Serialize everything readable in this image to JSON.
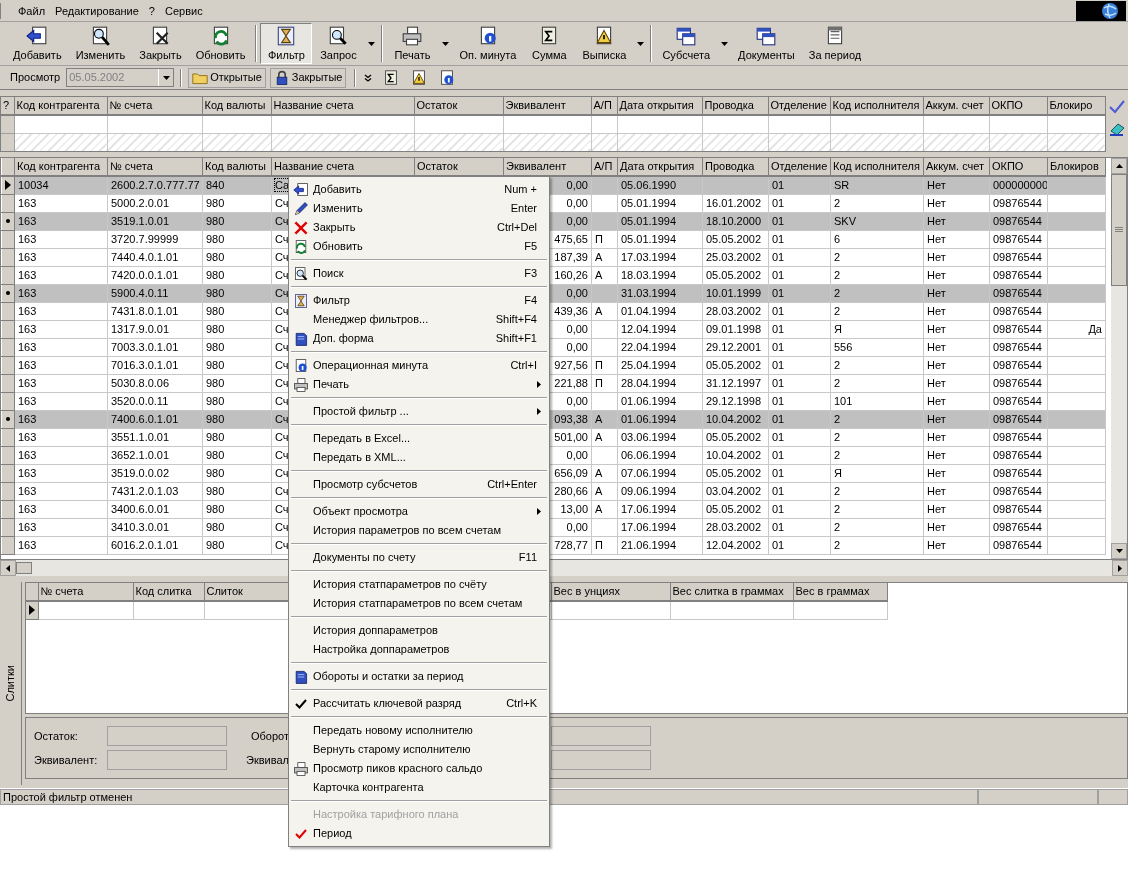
{
  "menu_bar": [
    {
      "label": "Файл"
    },
    {
      "label": "Редактирование"
    },
    {
      "label": "?"
    },
    {
      "label": "Сервис"
    }
  ],
  "toolbar": [
    {
      "kind": "button",
      "label": "Добавить",
      "pressed": false
    },
    {
      "kind": "button",
      "label": "Изменить",
      "pressed": false
    },
    {
      "kind": "button",
      "label": "Закрыть",
      "pressed": false
    },
    {
      "kind": "button",
      "label": "Обновить",
      "pressed": false
    },
    {
      "kind": "separator"
    },
    {
      "kind": "button",
      "label": "Фильтр",
      "pressed": true
    },
    {
      "kind": "button",
      "label": "Запрос",
      "pressed": false,
      "dropdown": true
    },
    {
      "kind": "separator"
    },
    {
      "kind": "button",
      "label": "Печать",
      "pressed": false,
      "dropdown": true
    },
    {
      "kind": "button",
      "label": "Оп. минута",
      "pressed": false
    },
    {
      "kind": "button",
      "label": "Сумма",
      "pressed": false
    },
    {
      "kind": "button",
      "label": "Выписка",
      "pressed": false,
      "dropdown": true
    },
    {
      "kind": "separator"
    },
    {
      "kind": "button",
      "label": "Субсчета",
      "pressed": false,
      "dropdown": true
    },
    {
      "kind": "button",
      "label": "Документы",
      "pressed": false
    },
    {
      "kind": "button",
      "label": "За период",
      "pressed": false
    }
  ],
  "view_bar": {
    "label": "Просмотр",
    "date": "05.05.2002",
    "date_disabled": true,
    "buttons": [
      {
        "label": "Открытые"
      },
      {
        "label": "Закрытые"
      }
    ]
  },
  "filter_grid": {
    "corner": "?",
    "columns": [
      "Код контрагента",
      "№ счета",
      "Код валюты",
      "Название счета",
      "Остаток",
      "Эквивалент",
      "А/П",
      "Дата открытия",
      "Проводка",
      "Отделение",
      "Код исполнителя",
      "Аккум. счет",
      "ОКПО",
      "Блокиро"
    ]
  },
  "main_grid": {
    "columns": [
      "Код контрагента",
      "№ счета",
      "Код валюты",
      "Название счета",
      "Остаток",
      "Эквивалент",
      "А/П",
      "Дата открытия",
      "Проводка",
      "Отделение",
      "Код исполнителя",
      "Аккум. счет",
      "ОКПО",
      "Блокиров"
    ],
    "rows": [
      {
        "current": true,
        "selected": true,
        "cells": [
          "10034",
          "2600.2.7.0.777.77",
          "840",
          "Са",
          null,
          "0,00",
          null,
          "05.06.1990",
          null,
          "01",
          "SR",
          "Нет",
          "000000000",
          null
        ]
      },
      {
        "current": false,
        "marked": false,
        "selected": false,
        "cells": [
          "163",
          "5000.2.0.01",
          "980",
          "Сч",
          null,
          "0,00",
          null,
          "05.01.1994",
          "16.01.2002",
          "01",
          "2",
          "Нет",
          "09876544",
          null
        ]
      },
      {
        "current": false,
        "marked": true,
        "selected": true,
        "cells": [
          "163",
          "3519.1.0.01",
          "980",
          "Сч",
          null,
          "0,00",
          null,
          "05.01.1994",
          "18.10.2000",
          "01",
          "SKV",
          "Нет",
          "09876544",
          null
        ]
      },
      {
        "current": false,
        "marked": false,
        "selected": false,
        "cells": [
          "163",
          "3720.7.99999",
          "980",
          "Сч",
          null,
          "475,65",
          "П",
          "05.01.1994",
          "05.05.2002",
          "01",
          "6",
          "Нет",
          "09876544",
          null
        ]
      },
      {
        "current": false,
        "marked": false,
        "selected": false,
        "cells": [
          "163",
          "7440.4.0.1.01",
          "980",
          "Сч",
          null,
          "187,39",
          "А",
          "17.03.1994",
          "25.03.2002",
          "01",
          "2",
          "Нет",
          "09876544",
          null
        ]
      },
      {
        "current": false,
        "marked": false,
        "selected": false,
        "cells": [
          "163",
          "7420.0.0.1.01",
          "980",
          "Сч",
          null,
          "160,26",
          "А",
          "18.03.1994",
          "05.05.2002",
          "01",
          "2",
          "Нет",
          "09876544",
          null
        ]
      },
      {
        "current": false,
        "marked": true,
        "selected": true,
        "cells": [
          "163",
          "5900.4.0.11",
          "980",
          "Сч",
          null,
          "0,00",
          null,
          "31.03.1994",
          "10.01.1999",
          "01",
          "2",
          "Нет",
          "09876544",
          null
        ]
      },
      {
        "current": false,
        "marked": false,
        "selected": false,
        "cells": [
          "163",
          "7431.8.0.1.01",
          "980",
          "Сч",
          null,
          "439,36",
          "А",
          "01.04.1994",
          "28.03.2002",
          "01",
          "2",
          "Нет",
          "09876544",
          null
        ]
      },
      {
        "current": false,
        "marked": false,
        "selected": false,
        "cells": [
          "163",
          "1317.9.0.01",
          "980",
          "Сч",
          null,
          "0,00",
          null,
          "12.04.1994",
          "09.01.1998",
          "01",
          "Я",
          "Нет",
          "09876544",
          "Да"
        ]
      },
      {
        "current": false,
        "marked": false,
        "selected": false,
        "cells": [
          "163",
          "7003.3.0.1.01",
          "980",
          "Сч",
          null,
          "0,00",
          null,
          "22.04.1994",
          "29.12.2001",
          "01",
          "556",
          "Нет",
          "09876544",
          null
        ]
      },
      {
        "current": false,
        "marked": false,
        "selected": false,
        "cells": [
          "163",
          "7016.3.0.1.01",
          "980",
          "Сч",
          null,
          "927,56",
          "П",
          "25.04.1994",
          "05.05.2002",
          "01",
          "2",
          "Нет",
          "09876544",
          null
        ]
      },
      {
        "current": false,
        "marked": false,
        "selected": false,
        "cells": [
          "163",
          "5030.8.0.06",
          "980",
          "Сч",
          null,
          "221,88",
          "П",
          "28.04.1994",
          "31.12.1997",
          "01",
          "2",
          "Нет",
          "09876544",
          null
        ]
      },
      {
        "current": false,
        "marked": false,
        "selected": false,
        "cells": [
          "163",
          "3520.0.0.11",
          "980",
          "Сч",
          null,
          "0,00",
          null,
          "01.06.1994",
          "29.12.1998",
          "01",
          "101",
          "Нет",
          "09876544",
          null
        ]
      },
      {
        "current": false,
        "marked": true,
        "selected": true,
        "cells": [
          "163",
          "7400.6.0.1.01",
          "980",
          "Сч",
          null,
          "093,38",
          "А",
          "01.06.1994",
          "10.04.2002",
          "01",
          "2",
          "Нет",
          "09876544",
          null
        ]
      },
      {
        "current": false,
        "marked": false,
        "selected": false,
        "cells": [
          "163",
          "3551.1.0.01",
          "980",
          "Сч",
          null,
          "501,00",
          "А",
          "03.06.1994",
          "05.05.2002",
          "01",
          "2",
          "Нет",
          "09876544",
          null
        ]
      },
      {
        "current": false,
        "marked": false,
        "selected": false,
        "cells": [
          "163",
          "3652.1.0.01",
          "980",
          "Сч",
          null,
          "0,00",
          null,
          "06.06.1994",
          "10.04.2002",
          "01",
          "2",
          "Нет",
          "09876544",
          null
        ]
      },
      {
        "current": false,
        "marked": false,
        "selected": false,
        "cells": [
          "163",
          "3519.0.0.02",
          "980",
          "Сч",
          null,
          "656,09",
          "А",
          "07.06.1994",
          "05.05.2002",
          "01",
          "Я",
          "Нет",
          "09876544",
          null
        ]
      },
      {
        "current": false,
        "marked": false,
        "selected": false,
        "cells": [
          "163",
          "7431.2.0.1.03",
          "980",
          "Сч",
          null,
          "280,66",
          "А",
          "09.06.1994",
          "03.04.2002",
          "01",
          "2",
          "Нет",
          "09876544",
          null
        ]
      },
      {
        "current": false,
        "marked": false,
        "selected": false,
        "cells": [
          "163",
          "3400.6.0.01",
          "980",
          "Сч",
          null,
          "13,00",
          "А",
          "17.06.1994",
          "05.05.2002",
          "01",
          "2",
          "Нет",
          "09876544",
          null
        ]
      },
      {
        "current": false,
        "marked": false,
        "selected": false,
        "cells": [
          "163",
          "3410.3.0.01",
          "980",
          "Сч",
          null,
          "0,00",
          null,
          "17.06.1994",
          "28.03.2002",
          "01",
          "2",
          "Нет",
          "09876544",
          null
        ]
      },
      {
        "current": false,
        "marked": false,
        "selected": false,
        "cells": [
          "163",
          "6016.2.0.1.01",
          "980",
          "Сч",
          null,
          "728,77",
          "П",
          "21.06.1994",
          "12.04.2002",
          "01",
          "2",
          "Нет",
          "09876544",
          null
        ]
      }
    ]
  },
  "bars_panel": {
    "tab": "Слитки",
    "columns": [
      "№ счета",
      "Код слитка",
      "Слиток",
      null,
      "Вес в унциях",
      "Вес слитка в граммах",
      "Вес в граммах"
    ],
    "totals": [
      {
        "label": "Остаток:",
        "label2": "Оборот"
      },
      {
        "label": "Эквивалент:",
        "label2": "Эквивал"
      }
    ]
  },
  "status_bar": {
    "text": "Простой фильтр отменен"
  },
  "context_menu": [
    {
      "kind": "item",
      "label": "Добавить",
      "shortcut": "Num +"
    },
    {
      "kind": "item",
      "label": "Изменить",
      "shortcut": "Enter"
    },
    {
      "kind": "item",
      "label": "Закрыть",
      "shortcut": "Ctrl+Del"
    },
    {
      "kind": "item",
      "label": "Обновить",
      "shortcut": "F5"
    },
    {
      "kind": "separator"
    },
    {
      "kind": "item",
      "label": "Поиск",
      "shortcut": "F3"
    },
    {
      "kind": "separator"
    },
    {
      "kind": "item",
      "label": "Фильтр",
      "shortcut": "F4"
    },
    {
      "kind": "item",
      "label": "Менеджер фильтров...",
      "shortcut": "Shift+F4"
    },
    {
      "kind": "item",
      "label": "Доп. форма",
      "shortcut": "Shift+F1"
    },
    {
      "kind": "separator"
    },
    {
      "kind": "item",
      "label": "Операционная минута",
      "shortcut": "Ctrl+I"
    },
    {
      "kind": "item",
      "label": "Печать",
      "submenu": true
    },
    {
      "kind": "separator"
    },
    {
      "kind": "item",
      "label": "Простой фильтр ...",
      "submenu": true
    },
    {
      "kind": "separator"
    },
    {
      "kind": "item",
      "label": "Передать в Excel..."
    },
    {
      "kind": "item",
      "label": "Передать в XML..."
    },
    {
      "kind": "separator"
    },
    {
      "kind": "item",
      "label": "Просмотр субсчетов",
      "shortcut": "Ctrl+Enter"
    },
    {
      "kind": "separator"
    },
    {
      "kind": "item",
      "label": "Объект просмотра",
      "submenu": true
    },
    {
      "kind": "item",
      "label": "История параметров по всем счетам"
    },
    {
      "kind": "separator"
    },
    {
      "kind": "item",
      "label": "Документы по счету",
      "shortcut": "F11"
    },
    {
      "kind": "separator"
    },
    {
      "kind": "item",
      "label": "История статпараметров по счёту"
    },
    {
      "kind": "item",
      "label": "История статпараметров по всем счетам"
    },
    {
      "kind": "separator"
    },
    {
      "kind": "item",
      "label": "История доппараметров"
    },
    {
      "kind": "item",
      "label": "Настройка доппараметров"
    },
    {
      "kind": "separator"
    },
    {
      "kind": "item",
      "label": "Обороты и остатки за период"
    },
    {
      "kind": "separator"
    },
    {
      "kind": "item",
      "label": "Рассчитать ключевой разряд",
      "shortcut": "Ctrl+K",
      "checked": true,
      "color": "#000000"
    },
    {
      "kind": "separator"
    },
    {
      "kind": "item",
      "label": "Передать новому исполнителю"
    },
    {
      "kind": "item",
      "label": "Вернуть старому исполнителю"
    },
    {
      "kind": "item",
      "label": "Просмотр пиков красного сальдо"
    },
    {
      "kind": "item",
      "label": "Карточка контрагента"
    },
    {
      "kind": "separator"
    },
    {
      "kind": "item",
      "label": "Настройка тарифного плана",
      "disabled": true
    },
    {
      "kind": "item",
      "label": "Период",
      "checked": true,
      "color": "#e00000"
    }
  ]
}
